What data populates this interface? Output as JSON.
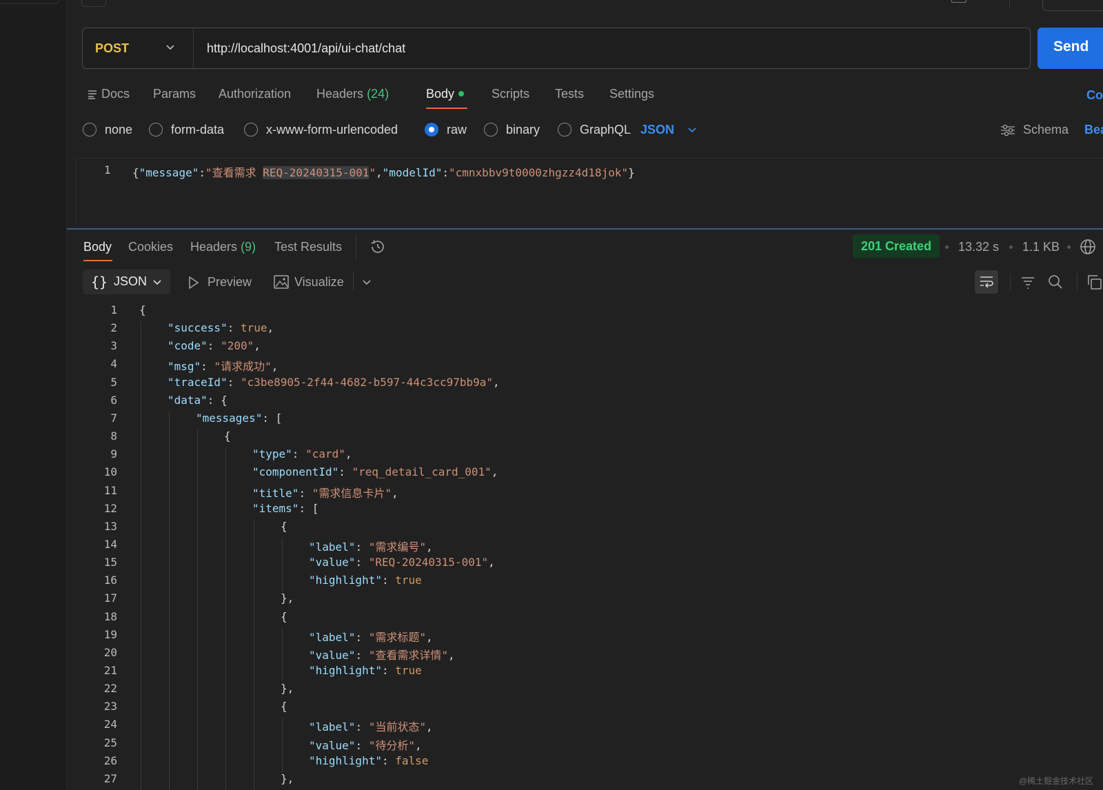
{
  "request": {
    "method": "POST",
    "url": "http://localhost:4001/api/ui-chat/chat",
    "send_label": "Send"
  },
  "req_tabs": [
    {
      "label": "Docs"
    },
    {
      "label": "Params"
    },
    {
      "label": "Authorization"
    },
    {
      "label": "Headers",
      "count": "(24)"
    },
    {
      "label": "Body"
    },
    {
      "label": "Scripts"
    },
    {
      "label": "Tests"
    },
    {
      "label": "Settings"
    }
  ],
  "req_tab_right": "Co",
  "body_options": {
    "items": [
      "none",
      "form-data",
      "x-www-form-urlencoded",
      "raw",
      "binary",
      "GraphQL"
    ],
    "selected": "raw",
    "format": "JSON",
    "schema_label": "Schema",
    "beautify_label": "Bea"
  },
  "request_body": {
    "line_no": "1",
    "key1": "\"message\"",
    "val1_pre": "\"查看需求 ",
    "val1_hl": "REQ-20240315-001",
    "val1_post": "\"",
    "key2": "\"modelId\"",
    "val2": "\"cmnxbbv9t0000zhgzz4d18jok\""
  },
  "response": {
    "tabs": [
      {
        "label": "Body"
      },
      {
        "label": "Cookies"
      },
      {
        "label": "Headers",
        "count": "(9)"
      },
      {
        "label": "Test Results"
      }
    ],
    "status": "201 Created",
    "time": "13.32 s",
    "size": "1.1 KB",
    "format": "JSON",
    "preview_label": "Preview",
    "visualize_label": "Visualize"
  },
  "response_lines": [
    {
      "n": "1",
      "indent": 0,
      "parts": [
        [
          "p",
          "{"
        ]
      ]
    },
    {
      "n": "2",
      "indent": 1,
      "parts": [
        [
          "k",
          "\"success\""
        ],
        [
          "p",
          ": "
        ],
        [
          "b",
          "true"
        ],
        [
          "p",
          ","
        ]
      ]
    },
    {
      "n": "3",
      "indent": 1,
      "parts": [
        [
          "k",
          "\"code\""
        ],
        [
          "p",
          ": "
        ],
        [
          "s",
          "\"200\""
        ],
        [
          "p",
          ","
        ]
      ]
    },
    {
      "n": "4",
      "indent": 1,
      "parts": [
        [
          "k",
          "\"msg\""
        ],
        [
          "p",
          ": "
        ],
        [
          "s",
          "\"请求成功\""
        ],
        [
          "p",
          ","
        ]
      ]
    },
    {
      "n": "5",
      "indent": 1,
      "parts": [
        [
          "k",
          "\"traceId\""
        ],
        [
          "p",
          ": "
        ],
        [
          "s",
          "\"c3be8905-2f44-4682-b597-44c3cc97bb9a\""
        ],
        [
          "p",
          ","
        ]
      ]
    },
    {
      "n": "6",
      "indent": 1,
      "parts": [
        [
          "k",
          "\"data\""
        ],
        [
          "p",
          ": {"
        ]
      ]
    },
    {
      "n": "7",
      "indent": 2,
      "parts": [
        [
          "k",
          "\"messages\""
        ],
        [
          "p",
          ": ["
        ]
      ]
    },
    {
      "n": "8",
      "indent": 3,
      "parts": [
        [
          "p",
          "{"
        ]
      ]
    },
    {
      "n": "9",
      "indent": 4,
      "parts": [
        [
          "k",
          "\"type\""
        ],
        [
          "p",
          ": "
        ],
        [
          "s",
          "\"card\""
        ],
        [
          "p",
          ","
        ]
      ]
    },
    {
      "n": "10",
      "indent": 4,
      "parts": [
        [
          "k",
          "\"componentId\""
        ],
        [
          "p",
          ": "
        ],
        [
          "s",
          "\"req_detail_card_001\""
        ],
        [
          "p",
          ","
        ]
      ]
    },
    {
      "n": "11",
      "indent": 4,
      "parts": [
        [
          "k",
          "\"title\""
        ],
        [
          "p",
          ": "
        ],
        [
          "s",
          "\"需求信息卡片\""
        ],
        [
          "p",
          ","
        ]
      ]
    },
    {
      "n": "12",
      "indent": 4,
      "parts": [
        [
          "k",
          "\"items\""
        ],
        [
          "p",
          ": ["
        ]
      ]
    },
    {
      "n": "13",
      "indent": 5,
      "parts": [
        [
          "p",
          "{"
        ]
      ]
    },
    {
      "n": "14",
      "indent": 6,
      "parts": [
        [
          "k",
          "\"label\""
        ],
        [
          "p",
          ": "
        ],
        [
          "s",
          "\"需求编号\""
        ],
        [
          "p",
          ","
        ]
      ]
    },
    {
      "n": "15",
      "indent": 6,
      "parts": [
        [
          "k",
          "\"value\""
        ],
        [
          "p",
          ": "
        ],
        [
          "s",
          "\"REQ-20240315-001\""
        ],
        [
          "p",
          ","
        ]
      ]
    },
    {
      "n": "16",
      "indent": 6,
      "parts": [
        [
          "k",
          "\"highlight\""
        ],
        [
          "p",
          ": "
        ],
        [
          "b",
          "true"
        ]
      ]
    },
    {
      "n": "17",
      "indent": 5,
      "parts": [
        [
          "p",
          "},"
        ]
      ]
    },
    {
      "n": "18",
      "indent": 5,
      "parts": [
        [
          "p",
          "{"
        ]
      ]
    },
    {
      "n": "19",
      "indent": 6,
      "parts": [
        [
          "k",
          "\"label\""
        ],
        [
          "p",
          ": "
        ],
        [
          "s",
          "\"需求标题\""
        ],
        [
          "p",
          ","
        ]
      ]
    },
    {
      "n": "20",
      "indent": 6,
      "parts": [
        [
          "k",
          "\"value\""
        ],
        [
          "p",
          ": "
        ],
        [
          "s",
          "\"查看需求详情\""
        ],
        [
          "p",
          ","
        ]
      ]
    },
    {
      "n": "21",
      "indent": 6,
      "parts": [
        [
          "k",
          "\"highlight\""
        ],
        [
          "p",
          ": "
        ],
        [
          "b",
          "true"
        ]
      ]
    },
    {
      "n": "22",
      "indent": 5,
      "parts": [
        [
          "p",
          "},"
        ]
      ]
    },
    {
      "n": "23",
      "indent": 5,
      "parts": [
        [
          "p",
          "{"
        ]
      ]
    },
    {
      "n": "24",
      "indent": 6,
      "parts": [
        [
          "k",
          "\"label\""
        ],
        [
          "p",
          ": "
        ],
        [
          "s",
          "\"当前状态\""
        ],
        [
          "p",
          ","
        ]
      ]
    },
    {
      "n": "25",
      "indent": 6,
      "parts": [
        [
          "k",
          "\"value\""
        ],
        [
          "p",
          ": "
        ],
        [
          "s",
          "\"待分析\""
        ],
        [
          "p",
          ","
        ]
      ]
    },
    {
      "n": "26",
      "indent": 6,
      "parts": [
        [
          "k",
          "\"highlight\""
        ],
        [
          "p",
          ": "
        ],
        [
          "b",
          "false"
        ]
      ]
    },
    {
      "n": "27",
      "indent": 5,
      "parts": [
        [
          "p",
          "},"
        ]
      ]
    }
  ],
  "watermark": "@稀土掘金技术社区"
}
